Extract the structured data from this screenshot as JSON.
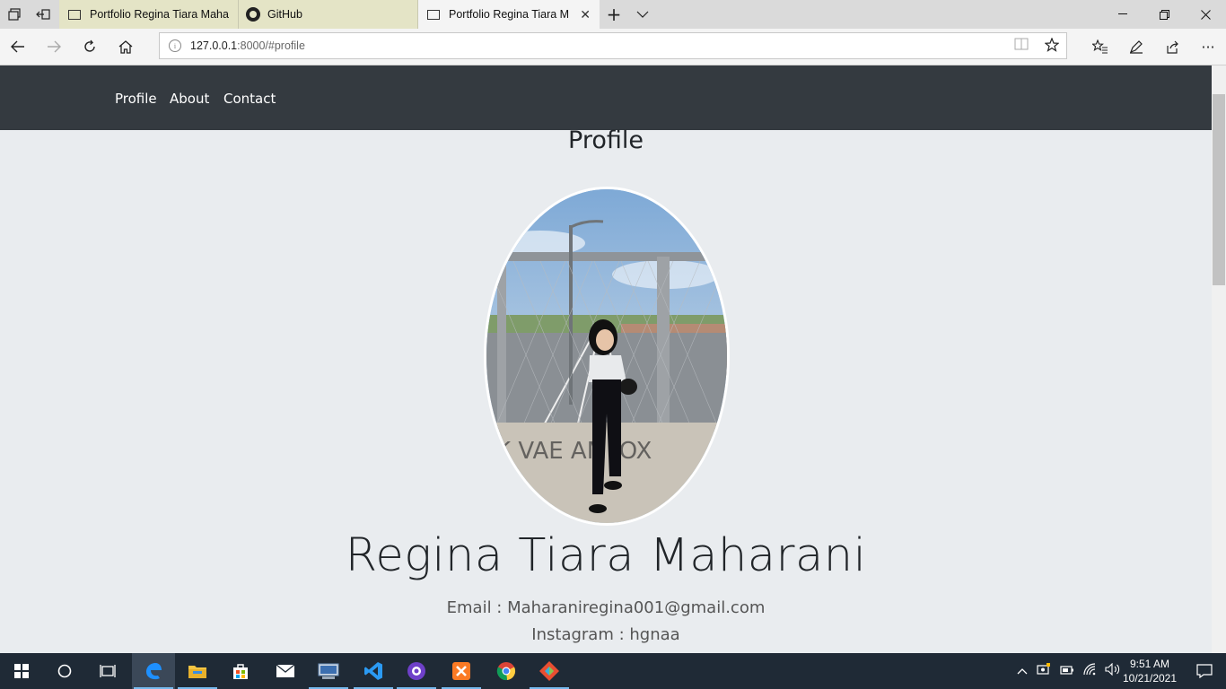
{
  "browser": {
    "tabs": [
      {
        "title": "Portfolio Regina Tiara Maha",
        "state": "inactive"
      },
      {
        "title": "GitHub",
        "state": "inactive"
      },
      {
        "title": "Portfolio Regina Tiara M",
        "state": "active"
      }
    ],
    "url_host": "127.0.0.1",
    "url_rest": ":8000/#profile"
  },
  "site": {
    "nav": {
      "profile": "Profile",
      "about": "About",
      "contact": "Contact"
    },
    "section_title": "Profile",
    "name": "Regina Tiara Maharani",
    "email_line": "Email : Maharaniregina001@gmail.com",
    "instagram_line": "Instagram : hgnaa"
  },
  "taskbar": {
    "apps": [
      "start-icon",
      "cortana-icon",
      "task-view-icon",
      "edge-icon",
      "file-explorer-icon",
      "store-icon",
      "mail-icon",
      "network-app-icon",
      "vscode-icon",
      "github-desktop-icon",
      "xampp-icon",
      "chrome-icon",
      "git-icon"
    ],
    "time": "9:51 AM",
    "date": "10/21/2021"
  },
  "colors": {
    "navbar": "#343a40",
    "page_bg": "#e9ecef",
    "taskbar": "#1f2a36"
  }
}
